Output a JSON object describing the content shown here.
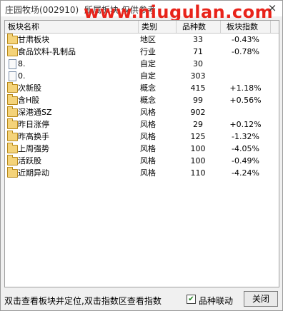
{
  "window": {
    "title": "庄园牧场(002910)",
    "title_suffix": "所属板块 仅供参考",
    "watermark": "www.niugulan.com",
    "close_glyph": "×"
  },
  "table": {
    "headers": [
      "板块名称",
      "类别",
      "品种数",
      "板块指数"
    ],
    "rows": [
      {
        "icon": "folder",
        "name": "甘肃板块",
        "type": "地区",
        "count": "33",
        "index": "-0.43%"
      },
      {
        "icon": "folder",
        "name": "食品饮料-乳制品",
        "type": "行业",
        "count": "71",
        "index": "-0.78%"
      },
      {
        "icon": "doc",
        "name": "8.",
        "type": "自定",
        "count": "30",
        "index": ""
      },
      {
        "icon": "doc",
        "name": "0.",
        "type": "自定",
        "count": "303",
        "index": ""
      },
      {
        "icon": "folder",
        "name": "次新股",
        "type": "概念",
        "count": "415",
        "index": "+1.18%"
      },
      {
        "icon": "folder",
        "name": "含H股",
        "type": "概念",
        "count": "99",
        "index": "+0.56%"
      },
      {
        "icon": "folder",
        "name": "深港通SZ",
        "type": "风格",
        "count": "902",
        "index": ""
      },
      {
        "icon": "folder",
        "name": "昨日涨停",
        "type": "风格",
        "count": "29",
        "index": "+0.12%"
      },
      {
        "icon": "folder",
        "name": "昨高换手",
        "type": "风格",
        "count": "125",
        "index": "-1.32%"
      },
      {
        "icon": "folder",
        "name": "上周强势",
        "type": "风格",
        "count": "100",
        "index": "-4.05%"
      },
      {
        "icon": "folder",
        "name": "活跃股",
        "type": "风格",
        "count": "100",
        "index": "-0.49%"
      },
      {
        "icon": "folder",
        "name": "近期异动",
        "type": "风格",
        "count": "110",
        "index": "-4.24%"
      }
    ]
  },
  "status": {
    "hint": "双击查看板块并定位,双击指数区查看指数",
    "checkbox_label": "品种联动",
    "checkbox_checked": true,
    "check_glyph": "✔",
    "close_label": "关闭"
  }
}
